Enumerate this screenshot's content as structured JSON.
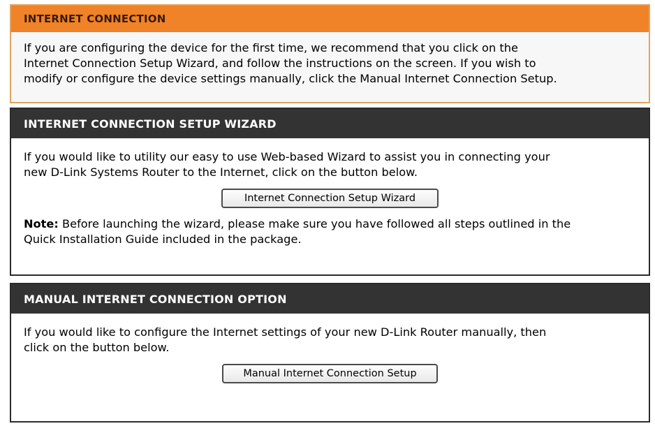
{
  "internet_connection": {
    "title": "INTERNET CONNECTION",
    "lines": [
      "If you are configuring the device for the first time, we recommend that you click on the",
      "Internet Connection Setup Wizard, and follow the instructions on the screen. If you wish to",
      "modify or configure the device settings manually, click the Manual Internet Connection Setup."
    ]
  },
  "setup_wizard": {
    "title": "INTERNET CONNECTION SETUP WIZARD",
    "lines": [
      "If you would like to utility our easy to use Web-based Wizard to assist you in connecting your",
      "new D-Link Systems Router to the Internet, click on the button below."
    ],
    "button_label": "Internet Connection Setup Wizard",
    "note_label": "Note:",
    "note_lines": [
      " Before launching the wizard, please make sure you have followed all steps outlined in the",
      "Quick Installation Guide included in the package."
    ]
  },
  "manual_option": {
    "title": "MANUAL INTERNET CONNECTION OPTION",
    "lines": [
      "If you would like to configure the Internet settings of your new D-Link Router manually, then",
      "click on the button below."
    ],
    "button_label": "Manual Internet Connection Setup"
  },
  "colors": {
    "orange_header": "#f08228",
    "orange_border": "#dfa55e",
    "dark_header": "#333333"
  }
}
